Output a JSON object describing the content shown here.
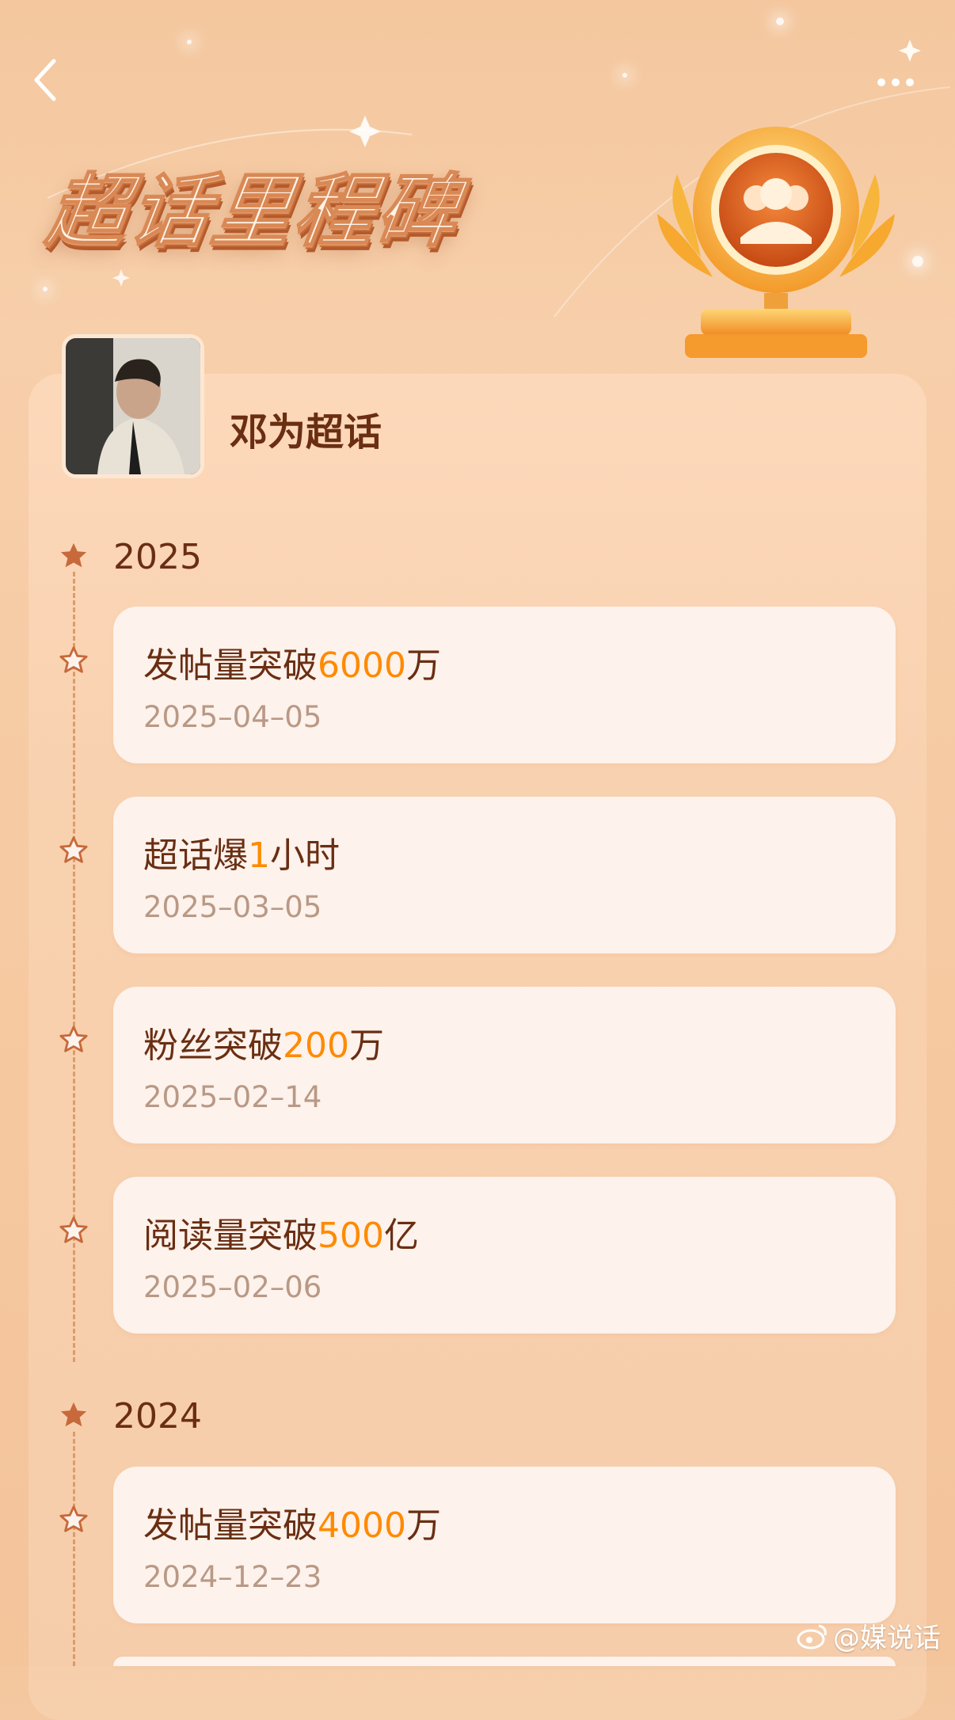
{
  "header": {
    "title": "超话里程碑",
    "back_icon": "chevron-left-icon",
    "more_icon": "more-dots-icon"
  },
  "topic": {
    "name": "邓为超话"
  },
  "timeline": [
    {
      "year": "2025",
      "items": [
        {
          "prefix": "发帖量突破",
          "number": "6000",
          "suffix": "万",
          "date": "2025–04–05"
        },
        {
          "prefix": "超话爆",
          "number": "1",
          "suffix": "小时",
          "date": "2025–03–05"
        },
        {
          "prefix": "粉丝突破",
          "number": "200",
          "suffix": "万",
          "date": "2025–02–14"
        },
        {
          "prefix": "阅读量突破",
          "number": "500",
          "suffix": "亿",
          "date": "2025–02–06"
        }
      ]
    },
    {
      "year": "2024",
      "items": [
        {
          "prefix": "发帖量突破",
          "number": "4000",
          "suffix": "万",
          "date": "2024–12–23"
        }
      ]
    }
  ],
  "watermark": "@媒说话",
  "colors": {
    "background": "#f6c9a1",
    "title_brown": "#6a2e12",
    "highlight_orange": "#ff8a00",
    "date_gray": "#b99985",
    "card_bg": "#fdf2ec"
  }
}
